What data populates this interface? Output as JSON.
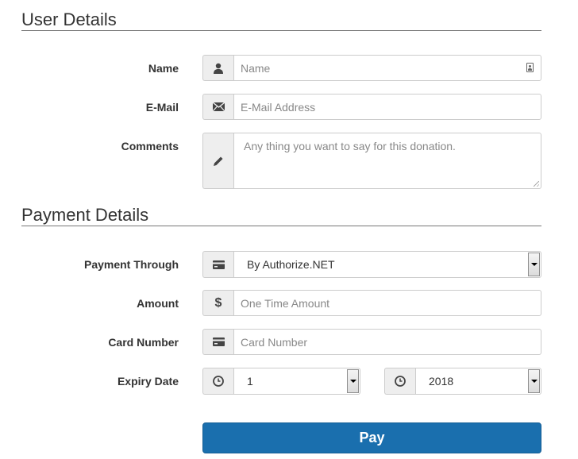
{
  "user_section": {
    "title": "User Details",
    "name": {
      "label": "Name",
      "placeholder": "Name",
      "icon": "user-icon"
    },
    "email": {
      "label": "E-Mail",
      "placeholder": "E-Mail Address",
      "icon": "envelope-icon"
    },
    "comments": {
      "label": "Comments",
      "placeholder": "Any thing you want to say for this donation.",
      "icon": "pencil-icon"
    }
  },
  "payment_section": {
    "title": "Payment Details",
    "payment_through": {
      "label": "Payment Through",
      "value": "By Authorize.NET",
      "icon": "credit-card-icon"
    },
    "amount": {
      "label": "Amount",
      "placeholder": "One Time Amount",
      "icon": "dollar-icon"
    },
    "card_number": {
      "label": "Card Number",
      "placeholder": "Card Number",
      "icon": "credit-card-icon"
    },
    "expiry": {
      "label": "Expiry Date",
      "month": "1",
      "year": "2018",
      "icon": "clock-icon"
    }
  },
  "pay_button": {
    "label": "Pay",
    "color": "#1a6fae"
  }
}
